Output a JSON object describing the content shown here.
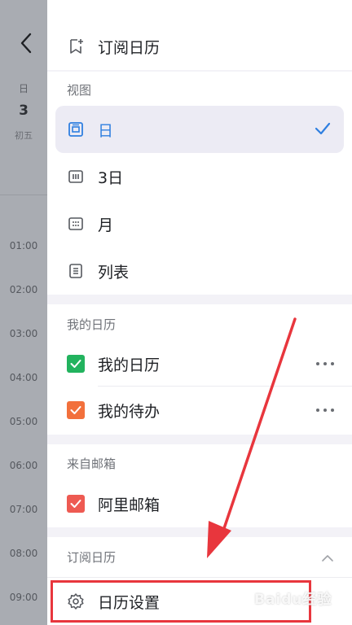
{
  "calendar_strip": {
    "weekday": "日",
    "day": "3",
    "lunar": "初五",
    "hours": [
      "01:00",
      "02:00",
      "03:00",
      "04:00",
      "05:00",
      "06:00",
      "07:00",
      "08:00",
      "09:00"
    ]
  },
  "drawer": {
    "subscribe_label": "订阅日历",
    "view_section": {
      "title": "视图",
      "items": [
        {
          "label": "日",
          "icon": "day-view-icon",
          "selected": true
        },
        {
          "label": "3日",
          "icon": "three-day-view-icon"
        },
        {
          "label": "月",
          "icon": "month-view-icon"
        },
        {
          "label": "列表",
          "icon": "list-view-icon"
        }
      ]
    },
    "my_calendars": {
      "title": "我的日历",
      "items": [
        {
          "label": "我的日历",
          "color": "#22b35e"
        },
        {
          "label": "我的待办",
          "color": "#f2703c"
        }
      ]
    },
    "from_mailbox": {
      "title": "来自邮箱",
      "items": [
        {
          "label": "阿里邮箱",
          "color": "#ee5a52"
        }
      ]
    },
    "subscribed": {
      "title": "订阅日历"
    },
    "settings_label": "日历设置"
  },
  "colors": {
    "accent": "#2f7fe0",
    "annotation": "#e8363d"
  },
  "watermark": "Baidu经验"
}
